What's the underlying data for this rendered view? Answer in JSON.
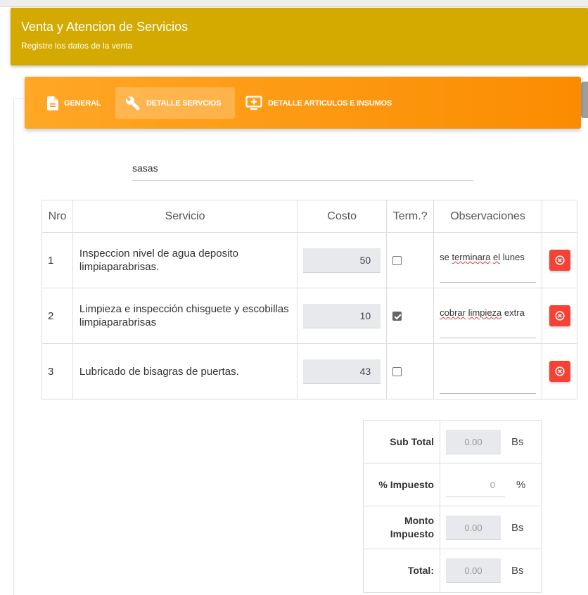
{
  "header": {
    "title": "Venta y Atencion de Servicios",
    "subtitle": "Registre los datos de la venta"
  },
  "tabs": [
    {
      "label": "GENERAL",
      "icon": "document-icon",
      "active": false
    },
    {
      "label": "DETALLE SERVCIOS",
      "icon": "wrench-icon",
      "active": true
    },
    {
      "label": "DETALLE ARTICULOS E INSUMOS",
      "icon": "add-to-queue-icon",
      "active": false
    }
  ],
  "client_field": {
    "value": "sasas"
  },
  "services_table": {
    "headers": {
      "nro": "Nro",
      "servicio": "Servicio",
      "costo": "Costo",
      "term": "Term.?",
      "obs": "Observaciones"
    },
    "rows": [
      {
        "nro": "1",
        "servicio": "Inspeccion nivel de agua deposito limpiaparabrisas.",
        "costo": "50",
        "terminado": false,
        "obs_prefix": "se ",
        "obs_spell": "terminara",
        "obs_mid": " ",
        "obs_spell2": "el",
        "obs_suffix": " lunes"
      },
      {
        "nro": "2",
        "servicio": "Limpieza e inspección chisguete y escobillas limpiaparabrisas",
        "costo": "10",
        "terminado": true,
        "obs_prefix": "",
        "obs_spell": "cobrar",
        "obs_mid": " ",
        "obs_spell2": "limpieza",
        "obs_suffix": " extra"
      },
      {
        "nro": "3",
        "servicio": "Lubricado de bisagras de puertas.",
        "costo": "43",
        "terminado": false,
        "obs_prefix": "",
        "obs_spell": "",
        "obs_mid": "",
        "obs_spell2": "",
        "obs_suffix": ""
      }
    ]
  },
  "totals": {
    "subtotal_label": "Sub Total",
    "subtotal_value": "0.00",
    "impuesto_label": "% Impuesto",
    "impuesto_value": "0",
    "monto_label_1": "Monto",
    "monto_label_2": "Impuesto",
    "monto_value": "0.00",
    "total_label": "Total:",
    "total_value": "0.00",
    "currency": "Bs",
    "percent": "%"
  },
  "colors": {
    "header_bg": "#d4aa00",
    "tabs_gradient_start": "#ffa726",
    "tabs_gradient_end": "#fb8c00",
    "delete_button": "#f44336"
  }
}
